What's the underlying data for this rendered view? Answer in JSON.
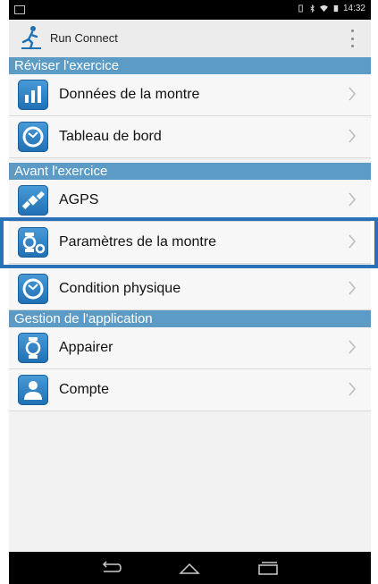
{
  "status_bar": {
    "time": "14:32"
  },
  "app": {
    "title": "Run Connect"
  },
  "sections": [
    {
      "title": "Réviser l'exercice",
      "items": [
        {
          "label": "Données de la montre",
          "icon": "bar-chart-icon"
        },
        {
          "label": "Tableau de bord",
          "icon": "dashboard-icon"
        }
      ]
    },
    {
      "title": "Avant l'exercice",
      "items": [
        {
          "label": "AGPS",
          "icon": "satellite-icon"
        },
        {
          "label": "Paramètres de la montre",
          "icon": "watch-settings-icon"
        },
        {
          "label": "Condition physique",
          "icon": "fitness-icon"
        }
      ]
    },
    {
      "title": "Gestion de l'application",
      "items": [
        {
          "label": "Appairer",
          "icon": "watch-icon"
        },
        {
          "label": "Compte",
          "icon": "account-icon"
        }
      ]
    }
  ],
  "colors": {
    "section_bg": "#5d9bc7",
    "icon_blue": "#1f6fb3",
    "highlight_border": "#2a71b8"
  }
}
